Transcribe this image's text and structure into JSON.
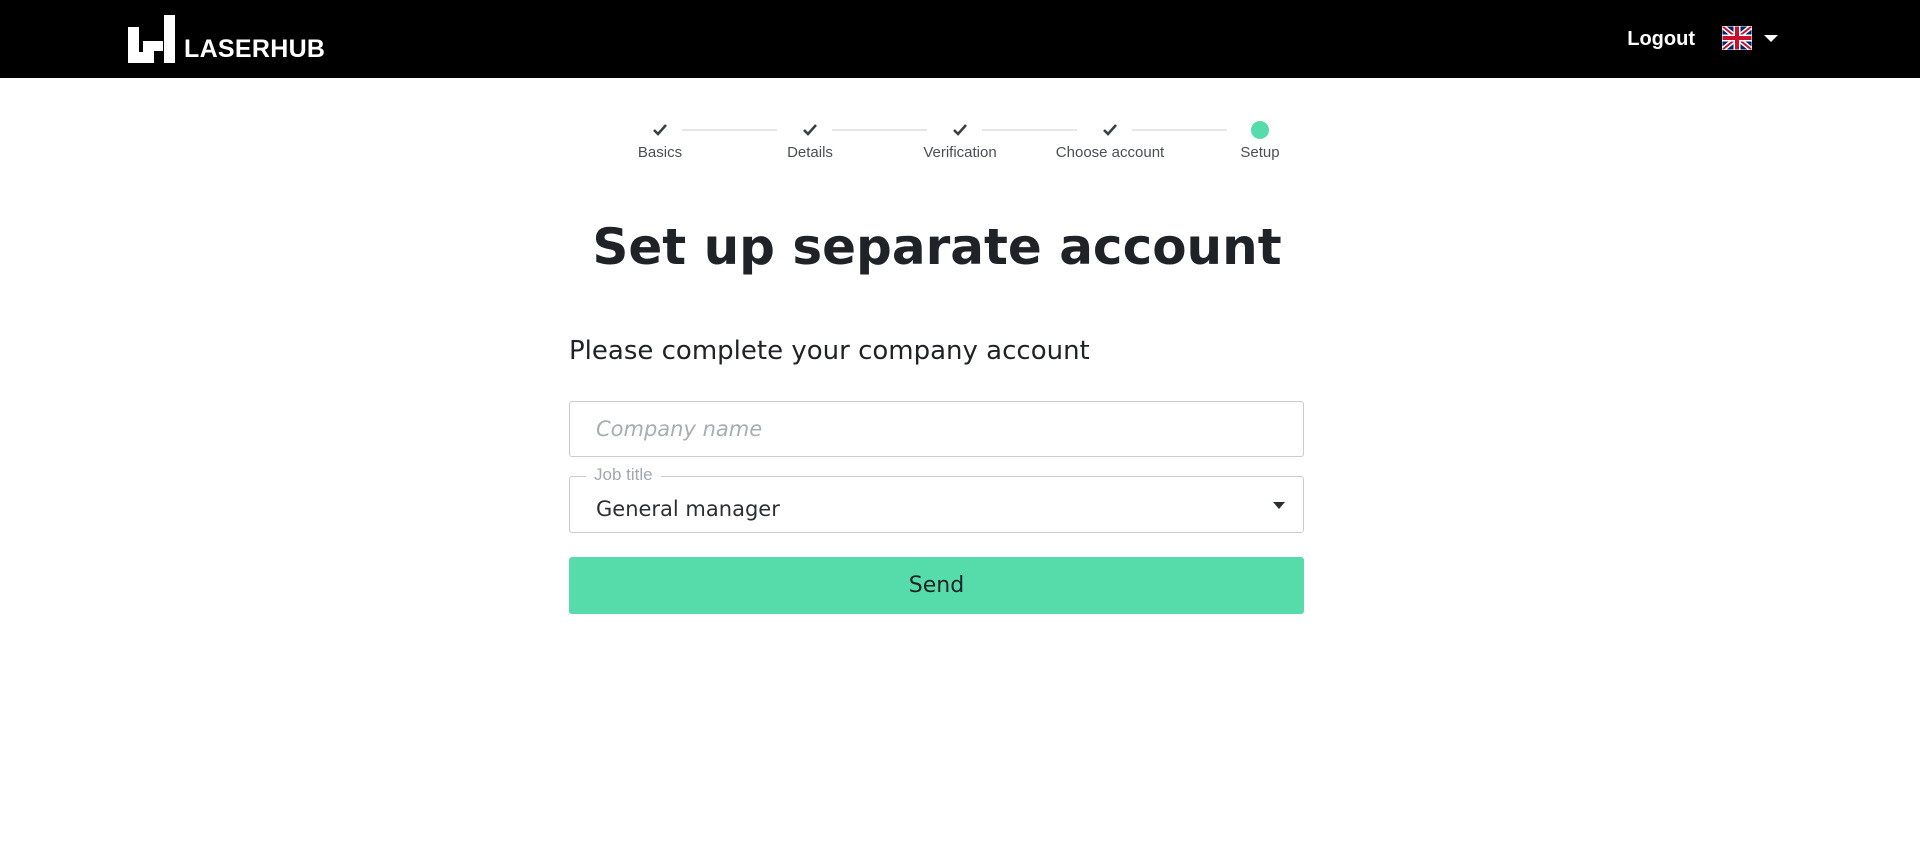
{
  "header": {
    "brand": "LASERHUB",
    "logout_label": "Logout",
    "language_icon": "uk-flag-icon"
  },
  "stepper": {
    "steps": [
      {
        "label": "Basics",
        "state": "done"
      },
      {
        "label": "Details",
        "state": "done"
      },
      {
        "label": "Verification",
        "state": "done"
      },
      {
        "label": "Choose account",
        "state": "done"
      },
      {
        "label": "Setup",
        "state": "current"
      }
    ]
  },
  "page": {
    "title": "Set up separate account",
    "subtitle": "Please complete your company account"
  },
  "form": {
    "company_placeholder": "Company name",
    "company_value": "",
    "job_title_label": "Job title",
    "job_title_value": "General manager",
    "send_label": "Send"
  },
  "colors": {
    "accent": "#56dbab",
    "header_bg": "#000000",
    "text": "#1f2226"
  }
}
